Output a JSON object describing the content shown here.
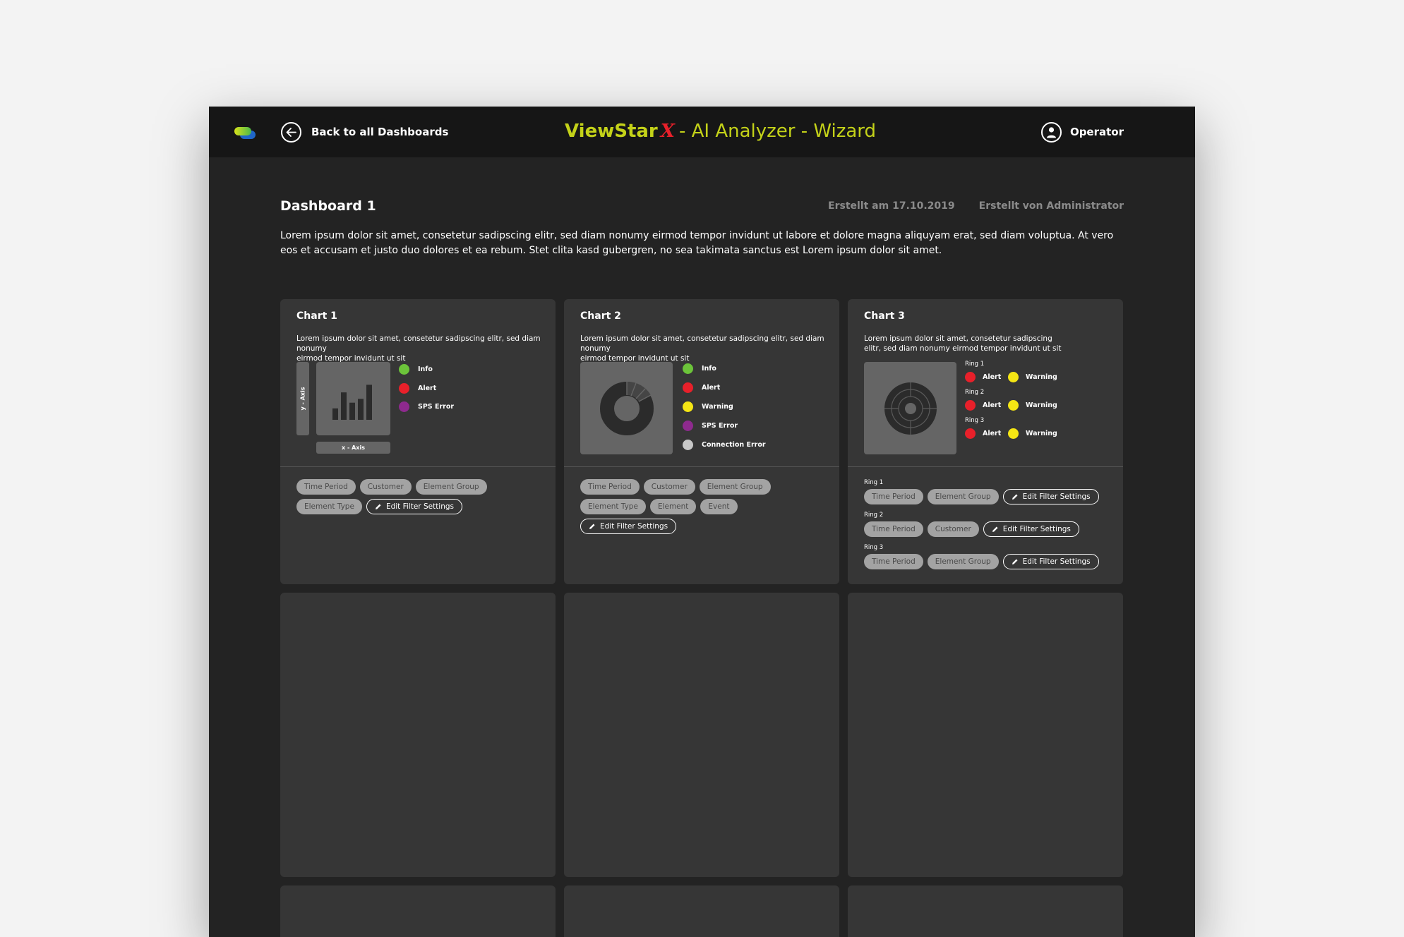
{
  "header": {
    "back_label": "Back to all Dashboards",
    "brand": "ViewStar",
    "brand_x": "X",
    "subtitle": "- AI Analyzer - Wizard",
    "user_label": "Operator"
  },
  "dashboard": {
    "title": "Dashboard 1",
    "created_on": "Erstellt am 17.10.2019",
    "created_by": "Erstellt von Administrator",
    "description": "Lorem ipsum dolor sit amet, consetetur sadipscing elitr, sed diam nonumy eirmod tempor invidunt ut labore et dolore magna aliquyam erat, sed diam voluptua. At vero eos et accusam et justo duo dolores et ea rebum. Stet clita kasd gubergren, no sea takimata sanctus est Lorem ipsum dolor sit amet."
  },
  "colors": {
    "accent": "#c4d219",
    "brand_x": "#e8202a",
    "info": "#6cc43a",
    "alert": "#e8202a",
    "sps_error": "#8e2a8e",
    "warning": "#f5e614",
    "connection_error": "#c8c8c8"
  },
  "chart1": {
    "title": "Chart 1",
    "desc_line1": "Lorem ipsum dolor sit amet, consetetur sadipscing elitr, sed diam nonumy",
    "desc_line2": "eirmod tempor invidunt ut sit",
    "y_axis": "y - Axis",
    "x_axis": "x - Axis",
    "bar_heights": [
      0.3,
      0.72,
      0.45,
      0.55,
      0.92
    ],
    "legend": [
      "Info",
      "Alert",
      "SPS Error"
    ],
    "chips": [
      "Time Period",
      "Customer",
      "Element Group",
      "Element Type"
    ],
    "edit_label": "Edit Filter Settings"
  },
  "chart2": {
    "title": "Chart 2",
    "desc_line1": "Lorem ipsum dolor sit amet, consetetur sadipscing elitr, sed diam nonumy",
    "desc_line2": "eirmod tempor invidunt ut sit",
    "legend": [
      "Info",
      "Alert",
      "Warning",
      "SPS Error",
      "Connection Error"
    ],
    "chips": [
      "Time Period",
      "Customer",
      "Element Group",
      "Element Type",
      "Element",
      "Event"
    ],
    "edit_label": "Edit Filter Settings"
  },
  "chart3": {
    "title": "Chart 3",
    "desc_line1": "Lorem ipsum dolor sit amet, consetetur sadipscing",
    "desc_line2": "elitr, sed diam nonumy eirmod tempor invidunt ut sit",
    "rings": [
      {
        "label": "Ring 1",
        "alert": "Alert",
        "warning": "Warning"
      },
      {
        "label": "Ring 2",
        "alert": "Alert",
        "warning": "Warning"
      },
      {
        "label": "Ring 3",
        "alert": "Alert",
        "warning": "Warning"
      }
    ],
    "filters": [
      {
        "label": "Ring 1",
        "chips": [
          "Time Period",
          "Element Group"
        ]
      },
      {
        "label": "Ring 2",
        "chips": [
          "Time Period",
          "Customer"
        ]
      },
      {
        "label": "Ring 3",
        "chips": [
          "Time Period",
          "Element Group"
        ]
      }
    ],
    "edit_label": "Edit Filter Settings"
  }
}
